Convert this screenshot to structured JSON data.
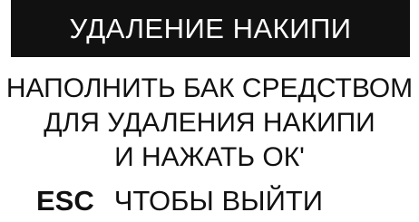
{
  "screen": {
    "title": "УДАЛЕНИЕ НАКИПИ",
    "message_lines": [
      "НАПОЛНИТЬ БАК СРЕДСТВОМ",
      "ДЛЯ УДАЛЕНИЯ НАКИПИ",
      "И НАЖАТЬ ОК'"
    ],
    "esc_key": "ESC",
    "esc_label": "ЧТОБЫ ВЫЙТИ"
  },
  "colors": {
    "background": "#ffffff",
    "title_bar": "#111111",
    "title_text": "#ffffff",
    "text": "#111111"
  }
}
